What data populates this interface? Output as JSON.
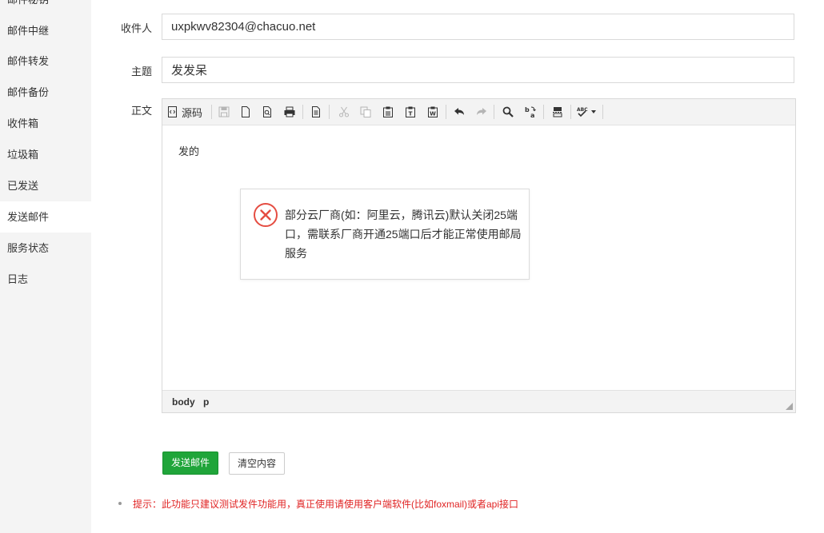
{
  "sidebar": {
    "items": [
      {
        "label": "邮件秘钥",
        "active": false
      },
      {
        "label": "邮件中继",
        "active": false
      },
      {
        "label": "邮件转发",
        "active": false
      },
      {
        "label": "邮件备份",
        "active": false
      },
      {
        "label": "收件箱",
        "active": false
      },
      {
        "label": "垃圾箱",
        "active": false
      },
      {
        "label": "已发送",
        "active": false
      },
      {
        "label": "发送邮件",
        "active": true
      },
      {
        "label": "服务状态",
        "active": false
      },
      {
        "label": "日志",
        "active": false
      }
    ]
  },
  "form": {
    "recipient_label": "收件人",
    "recipient_value": "uxpkwv82304@chacuo.net",
    "subject_label": "主题",
    "subject_value": "发发呆",
    "body_label": "正文"
  },
  "editor": {
    "source_label": "源码",
    "content": "发的",
    "path": [
      "body",
      "p"
    ]
  },
  "toast": {
    "message": "部分云厂商(如：阿里云，腾讯云)默认关闭25端口，需联系厂商开通25端口后才能正常使用邮局服务"
  },
  "actions": {
    "send_label": "发送邮件",
    "clear_label": "清空内容"
  },
  "tip": {
    "text": "提示：此功能只建议测试发件功能用，真正使用请使用客户端软件(比如foxmail)或者api接口"
  },
  "colors": {
    "primary": "#20a53a",
    "tip": "#e02424",
    "error_icon": "#e54d42"
  }
}
